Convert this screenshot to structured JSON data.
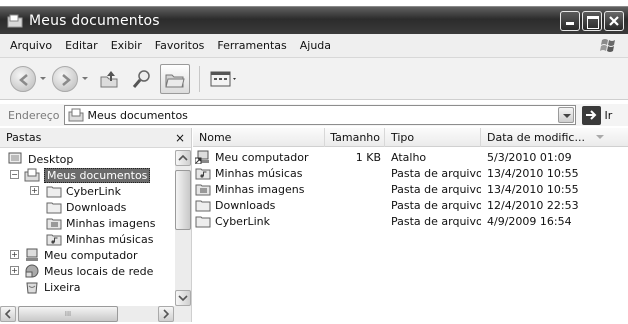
{
  "window": {
    "title": "Meus documentos",
    "colors": {
      "titlebar": "#2f2f2f",
      "selection": "#6b6b6b"
    }
  },
  "menu": [
    "Arquivo",
    "Editar",
    "Exibir",
    "Favoritos",
    "Ferramentas",
    "Ajuda"
  ],
  "toolbar": {
    "buttons": [
      "back-icon",
      "forward-icon",
      "up-folder-icon",
      "search-icon",
      "folders-icon",
      "views-icon"
    ]
  },
  "address": {
    "label": "Endereço",
    "value": "Meus documentos",
    "go_label": "Ir"
  },
  "folders_pane": {
    "title": "Pastas",
    "close_glyph": "×",
    "tree": [
      {
        "label": "Desktop",
        "icon": "desktop-icon",
        "expander": ""
      },
      {
        "label": "Meus documentos",
        "icon": "my-documents-icon",
        "expander": "−",
        "selected": true
      },
      {
        "label": "CyberLink",
        "icon": "folder-icon",
        "expander": "+"
      },
      {
        "label": "Downloads",
        "icon": "folder-icon",
        "expander": ""
      },
      {
        "label": "Minhas imagens",
        "icon": "pictures-folder-icon",
        "expander": ""
      },
      {
        "label": "Minhas músicas",
        "icon": "music-folder-icon",
        "expander": ""
      },
      {
        "label": "Meu computador",
        "icon": "computer-icon",
        "expander": "+"
      },
      {
        "label": "Meus locais de rede",
        "icon": "network-icon",
        "expander": "+"
      },
      {
        "label": "Lixeira",
        "icon": "recycle-bin-icon",
        "expander": ""
      }
    ],
    "hscroll_glyph": "III"
  },
  "file_list": {
    "columns": [
      "Nome",
      "Tamanho",
      "Tipo",
      "Data de modific..."
    ],
    "rows": [
      {
        "name": "Meu computador",
        "size": "1 KB",
        "type": "Atalho",
        "date": "5/3/2010 01:09",
        "icon": "shortcut-computer-icon"
      },
      {
        "name": "Minhas músicas",
        "size": "",
        "type": "Pasta de arquivos",
        "date": "13/4/2010 10:55",
        "icon": "music-folder-icon"
      },
      {
        "name": "Minhas imagens",
        "size": "",
        "type": "Pasta de arquivos",
        "date": "13/4/2010 10:55",
        "icon": "pictures-folder-icon"
      },
      {
        "name": "Downloads",
        "size": "",
        "type": "Pasta de arquivos",
        "date": "12/4/2010 22:53",
        "icon": "folder-icon"
      },
      {
        "name": "CyberLink",
        "size": "",
        "type": "Pasta de arquivos",
        "date": "4/9/2009 16:54",
        "icon": "folder-icon"
      }
    ]
  }
}
